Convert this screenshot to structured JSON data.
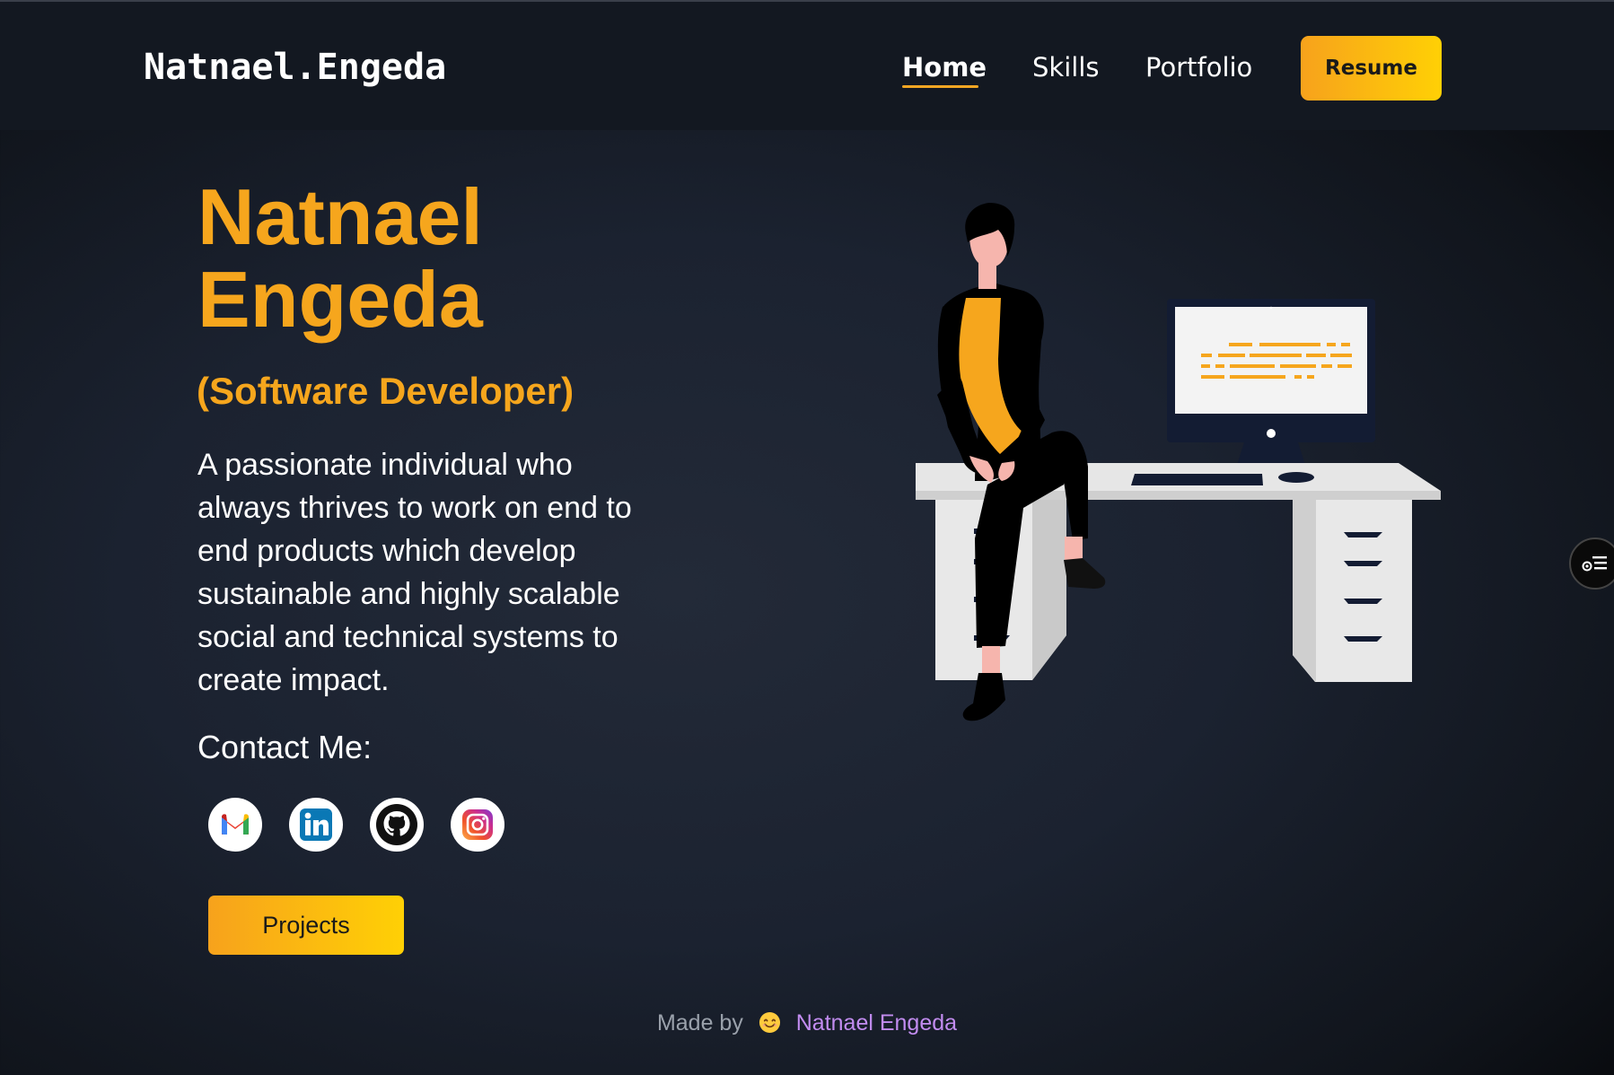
{
  "nav": {
    "brand": "Natnael.Engeda",
    "links": [
      "Home",
      "Skills",
      "Portfolio"
    ],
    "active": "Home",
    "resume_label": "Resume"
  },
  "hero": {
    "name_line1": "Natnael",
    "name_line2": "Engeda",
    "role": "(Software Developer)",
    "description_lines": [
      "A passionate individual who",
      "always thrives to work on end to",
      "end products which develop",
      "sustainable and highly scalable",
      "social and technical systems to",
      "create impact."
    ],
    "contact_label": "Contact Me:",
    "socials": [
      "gmail-icon",
      "linkedin-icon",
      "github-icon",
      "instagram-icon"
    ],
    "projects_label": "Projects"
  },
  "footer": {
    "made_by": "Made by",
    "author": "Natnael Engeda"
  },
  "colors": {
    "accent": "#f6a61d",
    "accent_gradient_end": "#ffd005",
    "footer_link": "#c28cf0",
    "background": "#1b2230"
  }
}
